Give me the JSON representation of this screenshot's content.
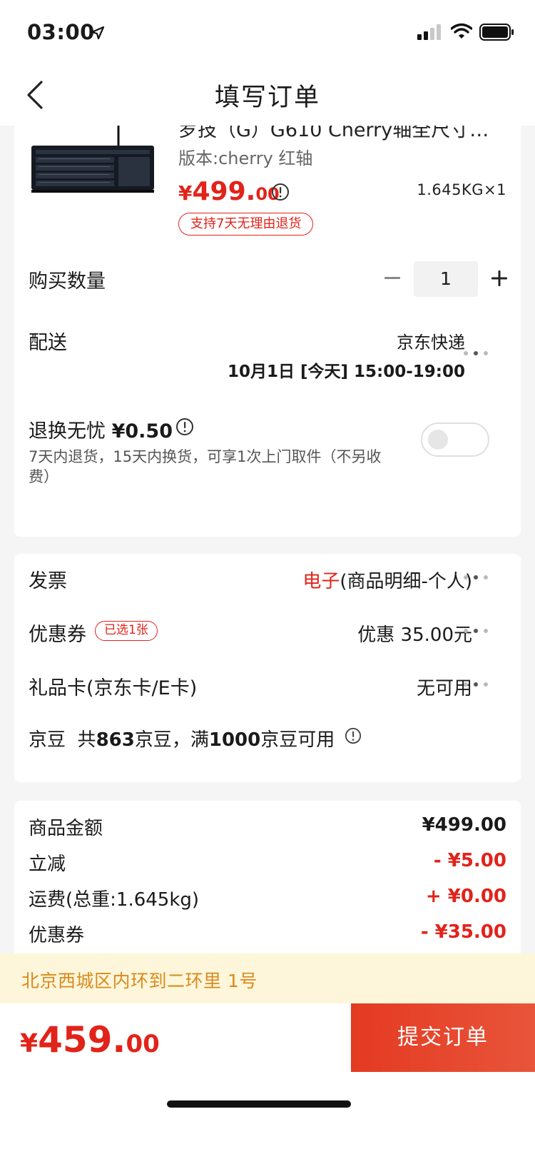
{
  "status_bar": {
    "time": "03:00"
  },
  "nav": {
    "title": "填写订单"
  },
  "product": {
    "title": "罗技（G）G610 Cherry轴全尺寸…",
    "spec": "版本:cherry 红轴",
    "price_symbol": "¥",
    "price_int": "499.",
    "price_dec": "00",
    "weight_qty": "1.645KG×1",
    "return_badge": "支持7天无理由退货"
  },
  "quantity": {
    "label": "购买数量",
    "value": "1"
  },
  "shipping": {
    "label": "配送",
    "carrier": "京东快递",
    "time": "10月1日 [今天] 15:00-19:00"
  },
  "worry_free": {
    "label": "退换无忧",
    "price": "¥0.50",
    "desc": "7天内退货，15天内换货，可享1次上门取件（不另收费）",
    "enabled": false
  },
  "invoice": {
    "label": "发票",
    "type": "电子",
    "detail": "(商品明细-个人)"
  },
  "coupon": {
    "label": "优惠券",
    "badge": "已选1张",
    "value": "优惠 35.00元"
  },
  "gift_card": {
    "label": "礼品卡(京东卡/E卡)",
    "value": "无可用"
  },
  "jd_bean": {
    "label": "京豆",
    "prefix": "共",
    "count": "863",
    "mid": "京豆，满",
    "threshold": "1000",
    "suffix": "京豆可用"
  },
  "summary": {
    "items": [
      {
        "label": "商品金额",
        "value": "¥499.00",
        "color": "#1a1a1a"
      },
      {
        "label": "立减",
        "value": "- ¥5.00",
        "color": "#e2231a"
      },
      {
        "label": "运费(总重:1.645kg)",
        "value": "+ ¥0.00",
        "color": "#e2231a"
      },
      {
        "label": "优惠券",
        "value": "- ¥35.00",
        "color": "#e2231a"
      }
    ]
  },
  "address": {
    "text": "北京西城区内环到二环里 1号"
  },
  "footer": {
    "total_symbol": "¥",
    "total_int": "459.",
    "total_dec": "00",
    "submit_label": "提交订单"
  },
  "colors": {
    "accent": "#e2231a",
    "address_bg": "#fdf6da",
    "address_text": "#d98a1e"
  }
}
